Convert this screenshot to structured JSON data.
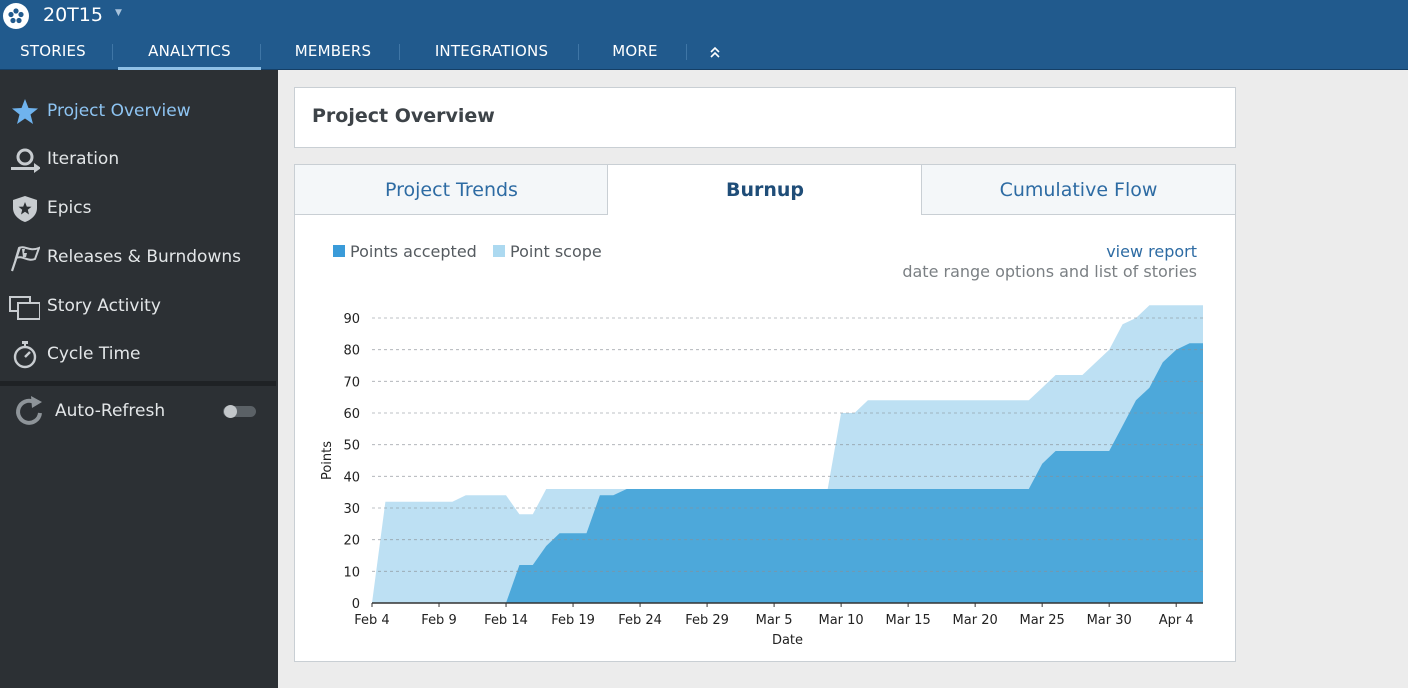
{
  "header": {
    "project_name": "20T15",
    "tabs": [
      {
        "label": "STORIES",
        "active": false
      },
      {
        "label": "ANALYTICS",
        "active": true
      },
      {
        "label": "MEMBERS",
        "active": false
      },
      {
        "label": "INTEGRATIONS",
        "active": false
      },
      {
        "label": "MORE",
        "active": false
      }
    ]
  },
  "sidebar": {
    "items": [
      {
        "label": "Project Overview",
        "icon": "star-icon",
        "active": true
      },
      {
        "label": "Iteration",
        "icon": "iteration-icon",
        "active": false
      },
      {
        "label": "Epics",
        "icon": "epic-shield-icon",
        "active": false
      },
      {
        "label": "Releases & Burndowns",
        "icon": "flag-icon",
        "active": false
      },
      {
        "label": "Story Activity",
        "icon": "story-activity-icon",
        "active": false
      },
      {
        "label": "Cycle Time",
        "icon": "stopwatch-icon",
        "active": false
      }
    ],
    "auto_refresh": {
      "label": "Auto-Refresh",
      "enabled": false
    }
  },
  "main": {
    "title": "Project Overview",
    "tabs": [
      {
        "label": "Project Trends",
        "active": false
      },
      {
        "label": "Burnup",
        "active": true
      },
      {
        "label": "Cumulative Flow",
        "active": false
      }
    ],
    "legend": [
      {
        "label": "Points accepted",
        "color": "#3a9bd9"
      },
      {
        "label": "Point scope",
        "color": "#acd9f0"
      }
    ],
    "view_report": "view report",
    "view_report_sub": "date range options and list of stories"
  },
  "colors": {
    "header_bg": "#215a8d",
    "sidebar_bg": "#2c3034",
    "accepted_fill": "#4da8da",
    "scope_fill": "#bde0f3",
    "active_link": "#8ec4f2"
  },
  "chart_data": {
    "type": "area",
    "title": "",
    "xlabel": "Date",
    "ylabel": "Points",
    "ylim": [
      0,
      90
    ],
    "yticks": [
      0,
      10,
      20,
      30,
      40,
      50,
      60,
      70,
      80,
      90
    ],
    "xlim": [
      "2024-02-04",
      "2024-04-06"
    ],
    "xticks": [
      {
        "date": "2024-02-04",
        "label": "Feb 4"
      },
      {
        "date": "2024-02-09",
        "label": "Feb 9"
      },
      {
        "date": "2024-02-14",
        "label": "Feb 14"
      },
      {
        "date": "2024-02-19",
        "label": "Feb 19"
      },
      {
        "date": "2024-02-24",
        "label": "Feb 24"
      },
      {
        "date": "2024-02-29",
        "label": "Feb 29"
      },
      {
        "date": "2024-03-05",
        "label": "Mar 5"
      },
      {
        "date": "2024-03-10",
        "label": "Mar 10"
      },
      {
        "date": "2024-03-15",
        "label": "Mar 15"
      },
      {
        "date": "2024-03-20",
        "label": "Mar 20"
      },
      {
        "date": "2024-03-25",
        "label": "Mar 25"
      },
      {
        "date": "2024-03-30",
        "label": "Mar 30"
      },
      {
        "date": "2024-04-04",
        "label": "Apr 4"
      }
    ],
    "grid": "dashed horizontal",
    "legend_position": "top-left",
    "series": [
      {
        "name": "Point scope",
        "color": "#bde0f3",
        "points": [
          [
            "2024-02-04",
            0
          ],
          [
            "2024-02-05",
            32
          ],
          [
            "2024-02-10",
            32
          ],
          [
            "2024-02-11",
            34
          ],
          [
            "2024-02-14",
            34
          ],
          [
            "2024-02-15",
            28
          ],
          [
            "2024-02-16",
            28
          ],
          [
            "2024-02-17",
            36
          ],
          [
            "2024-03-09",
            36
          ],
          [
            "2024-03-10",
            60
          ],
          [
            "2024-03-11",
            60
          ],
          [
            "2024-03-12",
            64
          ],
          [
            "2024-03-24",
            64
          ],
          [
            "2024-03-25",
            68
          ],
          [
            "2024-03-26",
            72
          ],
          [
            "2024-03-28",
            72
          ],
          [
            "2024-03-30",
            80
          ],
          [
            "2024-03-31",
            88
          ],
          [
            "2024-04-01",
            90
          ],
          [
            "2024-04-02",
            94
          ],
          [
            "2024-04-06",
            94
          ]
        ]
      },
      {
        "name": "Points accepted",
        "color": "#4da8da",
        "points": [
          [
            "2024-02-04",
            0
          ],
          [
            "2024-02-14",
            0
          ],
          [
            "2024-02-15",
            12
          ],
          [
            "2024-02-16",
            12
          ],
          [
            "2024-02-17",
            18
          ],
          [
            "2024-02-18",
            22
          ],
          [
            "2024-02-20",
            22
          ],
          [
            "2024-02-21",
            34
          ],
          [
            "2024-02-22",
            34
          ],
          [
            "2024-02-23",
            36
          ],
          [
            "2024-03-24",
            36
          ],
          [
            "2024-03-25",
            44
          ],
          [
            "2024-03-26",
            48
          ],
          [
            "2024-03-30",
            48
          ],
          [
            "2024-03-31",
            56
          ],
          [
            "2024-04-01",
            64
          ],
          [
            "2024-04-02",
            68
          ],
          [
            "2024-04-03",
            76
          ],
          [
            "2024-04-04",
            80
          ],
          [
            "2024-04-05",
            82
          ],
          [
            "2024-04-06",
            82
          ]
        ]
      }
    ]
  }
}
